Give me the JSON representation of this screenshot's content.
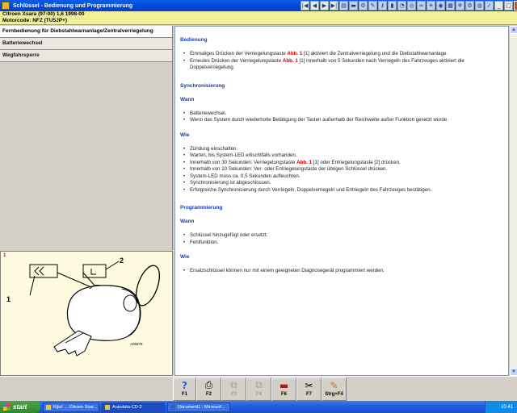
{
  "window": {
    "title": "Schlüssel - Bedienung und Programmierung"
  },
  "vehicle": {
    "line1": "Citroen   Xsara (97-00) 1,6   1998-00",
    "line2": "Motorcode: NFZ (TU5JP+)"
  },
  "nav": {
    "items": [
      {
        "label": "Fernbedienung für Diebstahlwarnanlage/Zentralverriegelung"
      },
      {
        "label": "Batteriewechsel"
      },
      {
        "label": "Wegfahrsperre"
      }
    ]
  },
  "figure": {
    "number": "1",
    "callout1": "1",
    "callout2": "2",
    "code": "A06878"
  },
  "content": {
    "h_bedienung": "Bedienung",
    "b1_pre": "Einmaliges Drücken der Verriegelungstaste ",
    "b1_abb": "Abb. 1",
    "b1_post": " [1] aktiviert die Zentralverriegelung und die Diebstahlwarnanlage.",
    "b2_pre": "Erneutes Drücken der Verriegelungstaste ",
    "b2_abb": "Abb. 1",
    "b2_post": " [1] innerhalb von 5 Sekunden nach Verriegeln des Fahrzeuges aktiviert die Doppelverriegelung.",
    "h_sync": "Synchronisierung",
    "h_wann1": "Wann",
    "w1": "Batteriewechsel.",
    "w2": "Wenn das System durch wiederholte Betätigung der Tasten außerhalb der Reichweite außer Funktion gesetzt wurde.",
    "h_wie1": "Wie",
    "s1": "Zündung einschalten.",
    "s2": "Warten, bis System-LED erlischtfalls vorhanden.",
    "s3_pre": "Innerhalb von 30 Sekunden: Verriegelungstaste ",
    "s3_abb": "Abb. 1",
    "s3_post": " [1] oder Entriegelungstaste [2] drücken.",
    "s4": "Innerhalb von 10 Sekunden: Ver- oder Entriegelungstaste der übrigen Schlüssel drücken.",
    "s5": "System-LED muss ca. 0,5 Sekunden aufleuchten.",
    "s6": "Synchronisierung ist abgeschlossen.",
    "s7": "Erfolgreiche Synchronisierung durch Verriegeln, Doppelverriegeln und Entriegeln des Fahrzeuges bestätigen.",
    "h_prog": "Programmierung",
    "h_wann2": "Wann",
    "p1": "Schlüssel hinzugefügt oder ersetzt.",
    "p2": "Fehlfunktion.",
    "h_wie2": "Wie",
    "q1": "Ersatzschlüssel können nur mit einem geeigneten Diagnosegerät programmiert werden."
  },
  "fkeys": [
    {
      "label": "F1",
      "icon": "help-icon"
    },
    {
      "label": "F2",
      "icon": "print-icon"
    },
    {
      "label": "F3",
      "icon": "copy-icon"
    },
    {
      "label": "F4",
      "icon": "note-icon"
    },
    {
      "label": "F6",
      "icon": "car-icon"
    },
    {
      "label": "F7",
      "icon": "tools-icon"
    },
    {
      "label": "Strg+F4",
      "icon": "notepad-icon"
    }
  ],
  "taskbar": {
    "start": "start",
    "tasks": [
      "Ključ ... Citroen Xsar...",
      "Autodata-CD-2",
      "Document1 - Microsof..."
    ],
    "clock": "10:41"
  },
  "colors": {
    "title_bar": "#0046d5",
    "vehicle_bar": "#f1ef9a",
    "heading": "#1a3aa8",
    "abb_ref": "#c00000"
  }
}
